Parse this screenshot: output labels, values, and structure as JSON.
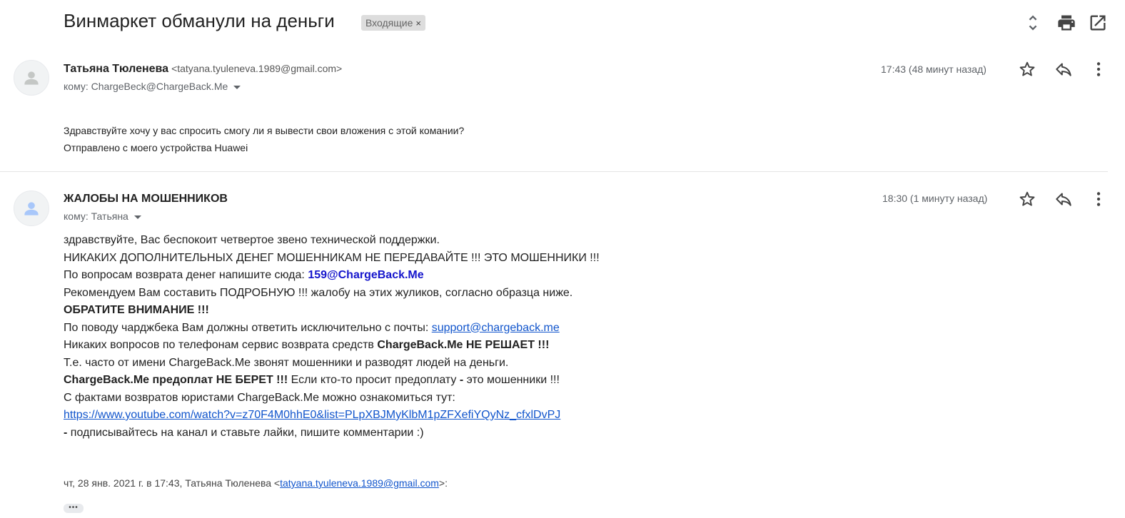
{
  "thread": {
    "subject": "Винмаркет обманули на деньги",
    "label": "Входящие",
    "label_close": "×"
  },
  "toolbar_icons": [
    "expand-collapse-icon",
    "print-icon",
    "open-in-new-window-icon"
  ],
  "messages": [
    {
      "sender_name": "Татьяна Тюленева",
      "sender_email": "<tatyana.tyuleneva.1989@gmail.com>",
      "to": "кому: ChargeBeck@ChargeBack.Me",
      "time": "17:43 (48 минут назад)",
      "body": [
        "Здравствуйте хочу у вас спросить смогу ли я вывести свои вложения с этой комании?",
        "Отправлено с моего устройства Huawei"
      ]
    },
    {
      "sender_name": "ЖАЛОБЫ НА МОШЕННИКОВ",
      "to": "кому: Татьяна",
      "time": "18:30 (1 минуту назад)",
      "body": {
        "l1": "здравствуйте, Вас беспокоит четвертое звено технической поддержки.",
        "l2": "НИКАКИХ ДОПОЛНИТЕЛЬНЫХ ДЕНЕГ МОШЕННИКАМ НЕ ПЕРЕДАВАЙТЕ !!! ЭТО МОШЕННИКИ !!!",
        "l3_text": "По вопросам возврата денег напишите сюда: ",
        "l3_link": "159@ChargeBack.Me",
        "l4": "Рекомендуем Вам составить ПОДРОБНУЮ !!! жалобу на этих жуликов, согласно образца ниже.",
        "l5": "ОБРАТИТЕ ВНИМАНИЕ !!!",
        "l6_text": "По поводу чарджбека Вам должны ответить исключительно с почты: ",
        "l6_link": "support@chargeback.me",
        "l7_text": "Никаких вопросов по телефонам сервис возврата средств ",
        "l7_bold": "ChargeBack.Me НЕ РЕШАЕТ !!!",
        "l8": "Т.е. часто от имени ChargeBack.Me звонят мошенники и разводят людей на деньги.",
        "l9_bold": "ChargeBack.Me предоплат НЕ БЕРЕТ !!!",
        "l9_text": " Если кто-то просит предоплату ",
        "l9_dash": "-",
        "l9_tail": " это мошенники !!!",
        "l10": "С фактами возвратов юристами ChargeBack.Me можно ознакомиться тут:",
        "l11_link": "https://www.youtube.com/watch?v=z70F4M0hhE0&list=PLpXBJMyKlbM1pZFXefiYQyNz_cfxlDvPJ",
        "l12_dash": " -",
        "l12_text": " подписывайтесь на канал и ставьте лайки, пишите комментарии :)"
      },
      "quote_prefix": "чт, 28 янв. 2021 г. в 17:43, Татьяна Тюленева <",
      "quote_email": "tatyana.tyuleneva.1989@gmail.com",
      "quote_suffix": ">:",
      "show_trimmed": "•••"
    }
  ]
}
